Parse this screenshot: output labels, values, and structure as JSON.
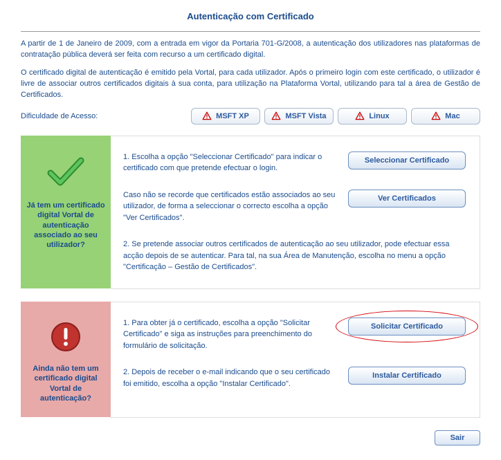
{
  "title": "Autenticação com Certificado",
  "intro_p1": "A partir de 1 de Janeiro de 2009, com a entrada em vigor da Portaria 701-G/2008, a autenticação dos utilizadores nas plataformas de contratação pública deverá ser feita com recurso a um certificado digital.",
  "intro_p2": "O certificado digital de autenticação é emitido pela Vortal, para cada utilizador. Após o primeiro login com este certificado, o utilizador é livre de associar outros certificados digitais à sua conta, para utilização na Plataforma Vortal, utilizando para tal a área de Gestão de Certificados.",
  "difficulty_label": "Dificuldade de Acesso:",
  "os_buttons": [
    "MSFT XP",
    "MSFT Vista",
    "Linux",
    "Mac"
  ],
  "card_green": {
    "side_label": "Já tem um certificado digital Vortal de autenticação associado ao seu utilizador?",
    "step1": "1. Escolha a opção \"Seleccionar Certificado\" para indicar o certificado com que pretende efectuar o login.",
    "btn1": "Seleccionar Certificado",
    "step2": "Caso não se recorde que certificados estão associados ao seu utilizador, de forma a seleccionar o correcto escolha a opção \"Ver Certificados\".",
    "btn2": "Ver Certificados",
    "note": "2. Se pretende associar outros certificados de autenticação ao seu utilizador, pode efectuar essa acção depois de se autenticar. Para tal, na sua Área de Manutenção, escolha no menu a opção \"Certificação – Gestão de Certificados\"."
  },
  "card_red": {
    "side_label": "Ainda não tem um certificado digital Vortal de autenticação?",
    "step1": "1. Para obter já o certificado, escolha a opção \"Solicitar Certificado\" e siga as instruções para preenchimento do formulário de solicitação.",
    "btn1": "Solicitar Certificado",
    "step2": "2. Depois de receber o e-mail indicando que o seu certificado foi emitido, escolha a opção \"Instalar Certificado\".",
    "btn2": "Instalar Certificado"
  },
  "exit_label": "Sair"
}
